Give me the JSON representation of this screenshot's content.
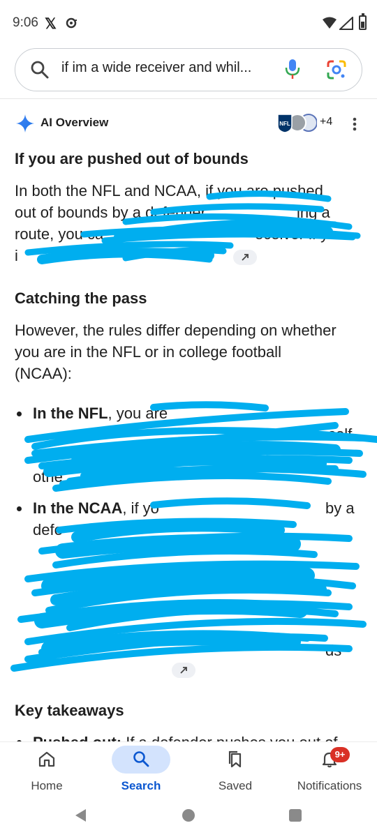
{
  "status": {
    "time": "9:06",
    "x_glyph": "𝕏"
  },
  "search": {
    "query": "if im a wide receiver and whil..."
  },
  "ai_overview": {
    "label": "AI Overview",
    "source_icon_text": "NFL",
    "sources_more": "+4",
    "section1_title": "If you are pushed out of bounds",
    "section1_line1": "In both the NFL and NCAA, if you are pushed",
    "section1_line2": "out of bounds by a defender",
    "section1_line2b": "ing a",
    "section1_line3": "route, you ca",
    "section1_line3b": "eceiver if yo",
    "section1_line4": "i",
    "section2_title": "Catching the pass",
    "section2_para_l1": "However, the rules differ depending on whether",
    "section2_para_l2": "you are in the NFL or in college football",
    "section2_para_l3": "(NCAA):",
    "bullet1_bold": "In the NFL",
    "bullet1_rest": ", you are",
    "bullet1_l2b": "self",
    "bullet1_l4": "othe",
    "bullet2_bold": "In the NCAA",
    "bullet2_rest": ", if yo",
    "bullet2_l1b": "by a",
    "bullet2_l2": "defe",
    "bullet2_l7b": "ds",
    "section3_title": "Key takeaways",
    "takeaway_bold": "Pushed out:",
    "takeaway_rest": " If a defender pushes you out of"
  },
  "nav": {
    "home": "Home",
    "search": "Search",
    "saved": "Saved",
    "notifications": "Notifications",
    "badge": "9+"
  },
  "colors": {
    "accent": "#0b57d0",
    "pill": "#d3e3fd",
    "scribble": "#00aeef",
    "badge": "#d93025"
  }
}
